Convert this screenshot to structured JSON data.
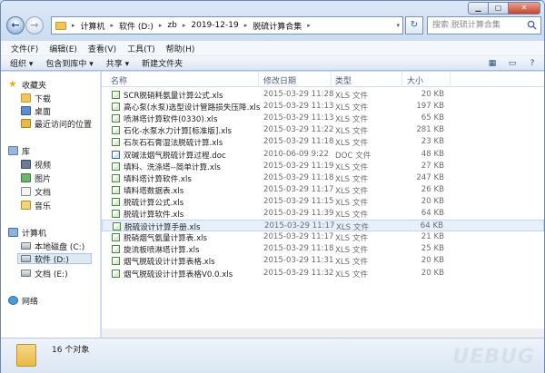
{
  "window": {
    "address_crumbs": [
      "计算机",
      "软件 (D:)",
      "zb",
      "2019-12-19",
      "脱硫计算合集"
    ],
    "search_placeholder": "搜索 脱硫计算合集"
  },
  "menu": [
    "文件(F)",
    "编辑(E)",
    "查看(V)",
    "工具(T)",
    "帮助(H)"
  ],
  "toolbar": {
    "organize": "组织 ▾",
    "include": "包含到库中 ▾",
    "share": "共享 ▾",
    "new_folder": "新建文件夹"
  },
  "nav": {
    "favorites": "收藏夹",
    "downloads": "下载",
    "desktop": "桌面",
    "recent": "最近访问的位置",
    "libraries": "库",
    "videos": "视频",
    "pictures": "图片",
    "documents": "文档",
    "music": "音乐",
    "computer": "计算机",
    "drive_c": "本地磁盘 (C:)",
    "drive_d": "软件 (D:)",
    "drive_e": "文档 (E:)",
    "network": "网络"
  },
  "columns": {
    "name": "名称",
    "date": "修改日期",
    "type": "类型",
    "size": "大小"
  },
  "files": [
    {
      "name": "SCR脱硝耗氨量计算公式.xls",
      "date": "2015-03-29 11:28",
      "type": "XLS 文件",
      "size": "20 KB"
    },
    {
      "name": "高心泵(水泵)选型设计管路损失压降.xls",
      "date": "2015-03-29 11:13",
      "type": "XLS 文件",
      "size": "197 KB"
    },
    {
      "name": "喷淋塔计算软件(0330).xls",
      "date": "2015-03-29 11:13",
      "type": "XLS 文件",
      "size": "65 KB"
    },
    {
      "name": "石化-水泵水力计算[标准版].xls",
      "date": "2015-03-29 11:22",
      "type": "XLS 文件",
      "size": "281 KB"
    },
    {
      "name": "石灰石石膏湿法脱硫计算.xls",
      "date": "2015-03-29 11:18",
      "type": "XLS 文件",
      "size": "23 KB"
    },
    {
      "name": "双碱法烟气脱硫计算过程.doc",
      "date": "2010-06-09 9:22",
      "type": "DOC 文件",
      "size": "48 KB"
    },
    {
      "name": "填料、洗涤塔--简单计算.xls",
      "date": "2015-03-29 11:19",
      "type": "XLS 文件",
      "size": "27 KB"
    },
    {
      "name": "填料塔计算软件.xls",
      "date": "2015-03-29 11:18",
      "type": "XLS 文件",
      "size": "247 KB"
    },
    {
      "name": "填料塔数据表.xls",
      "date": "2015-03-29 11:17",
      "type": "XLS 文件",
      "size": "26 KB"
    },
    {
      "name": "脱硫计算公式.xls",
      "date": "2015-03-29 11:15",
      "type": "XLS 文件",
      "size": "20 KB"
    },
    {
      "name": "脱硫计算软件.xls",
      "date": "2015-03-29 11:39",
      "type": "XLS 文件",
      "size": "64 KB"
    },
    {
      "name": "脱硫设计计算手册.xls",
      "date": "2015-03-29 11:17",
      "type": "XLS 文件",
      "size": "64 KB"
    },
    {
      "name": "脱硝烟气氨量计算表.xls",
      "date": "2015-03-29 11:17",
      "type": "XLS 文件",
      "size": "21 KB"
    },
    {
      "name": "旋流板喷淋塔计算.xls",
      "date": "2015-03-29 11:18",
      "type": "XLS 文件",
      "size": "25 KB"
    },
    {
      "name": "烟气脱硫设计计算表格.xls",
      "date": "2015-03-29 11:31",
      "type": "XLS 文件",
      "size": "20 KB"
    },
    {
      "name": "烟气脱硫设计计算表格V0.0.xls",
      "date": "2015-03-29 11:32",
      "type": "XLS 文件",
      "size": "20 KB"
    }
  ],
  "selected_index": 11,
  "status": {
    "count": "16 个对象"
  },
  "watermark": "UEBUG"
}
